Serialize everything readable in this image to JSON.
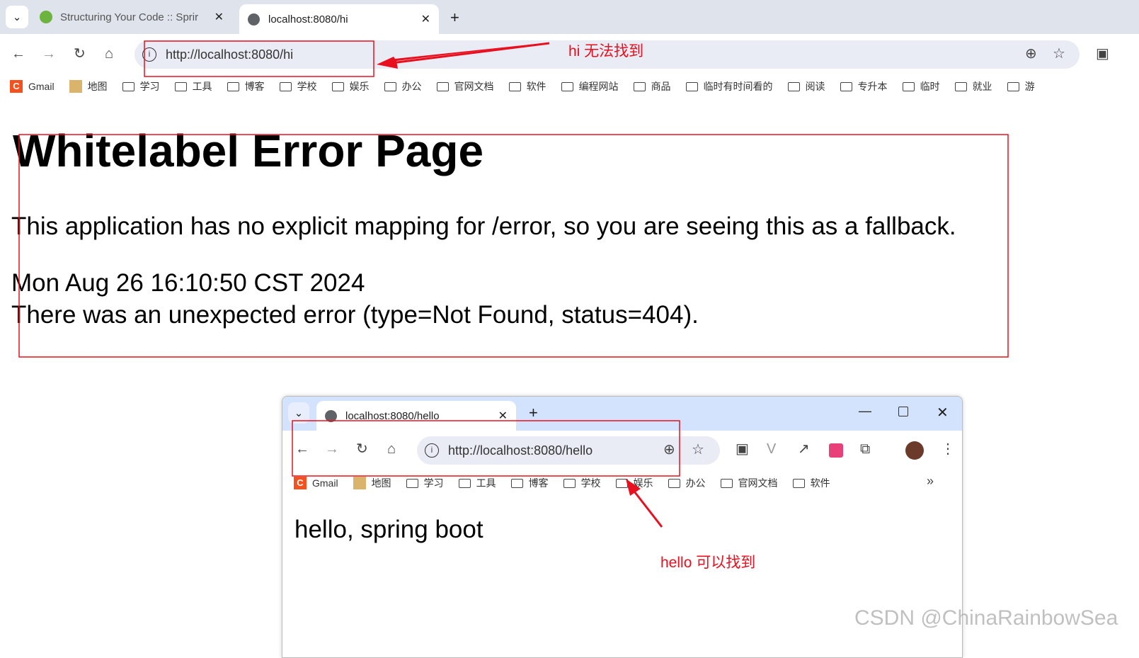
{
  "browser": {
    "tabs": [
      {
        "label": "Structuring Your Code :: Sprir",
        "icon": "spring-leaf-icon"
      },
      {
        "label": "localhost:8080/hi",
        "icon": "globe-icon",
        "active": true
      }
    ],
    "url": "http://localhost:8080/hi",
    "bookmarks": [
      "Gmail",
      "地图",
      "学习",
      "工具",
      "博客",
      "学校",
      "娱乐",
      "办公",
      "官网文档",
      "软件",
      "编程网站",
      "商品",
      "临时有时间看的",
      "阅读",
      "专升本",
      "临时",
      "就业",
      "游"
    ]
  },
  "page": {
    "title": "Whitelabel Error Page",
    "message": "This application has no explicit mapping for /error, so you are seeing this as a fallback.",
    "timestamp": "Mon Aug 26 16:10:50 CST 2024",
    "error": "There was an unexpected error (type=Not Found, status=404)."
  },
  "annotations": {
    "hi": "hi 无法找到",
    "hello": "hello 可以找到",
    "accent": "#e8101e"
  },
  "inner": {
    "tab": "localhost:8080/hello",
    "url": "http://localhost:8080/hello",
    "bookmarks": [
      "Gmail",
      "地图",
      "学习",
      "工具",
      "博客",
      "学校",
      "娱乐",
      "办公",
      "官网文档",
      "软件"
    ],
    "body": "hello, spring boot"
  },
  "watermark": "CSDN @ChinaRainbowSea"
}
